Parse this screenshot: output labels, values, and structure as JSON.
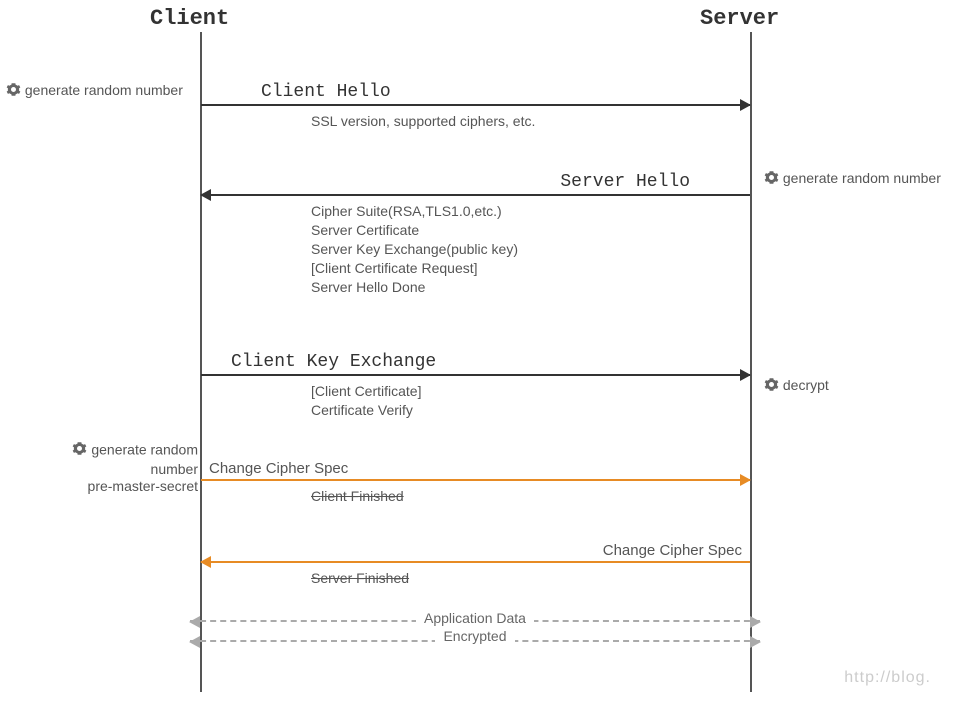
{
  "actors": {
    "client": "Client",
    "server": "Server"
  },
  "notes": {
    "gen1": "generate random number",
    "gen2": "generate random number",
    "decrypt": "decrypt",
    "premaster": "generate random number\npre-master-secret"
  },
  "msg": {
    "clientHello": {
      "title": "Client Hello",
      "body": "SSL version, supported ciphers, etc."
    },
    "serverHello": {
      "title": "Server Hello",
      "body": "Cipher Suite(RSA,TLS1.0,etc.)\nServer Certificate\nServer Key Exchange(public key)\n[Client Certificate Request]\nServer Hello Done"
    },
    "clientKey": {
      "title": "Client Key Exchange",
      "body": "[Client Certificate]\nCertificate Verify"
    },
    "ccs1": {
      "title": "Change Cipher Spec",
      "body": "Client Finished"
    },
    "ccs2": {
      "title": "Change Cipher Spec",
      "body": "Server Finished"
    },
    "appdata": {
      "line1": "Application Data",
      "line2": "Encrypted"
    }
  },
  "watermark": "http://blog."
}
